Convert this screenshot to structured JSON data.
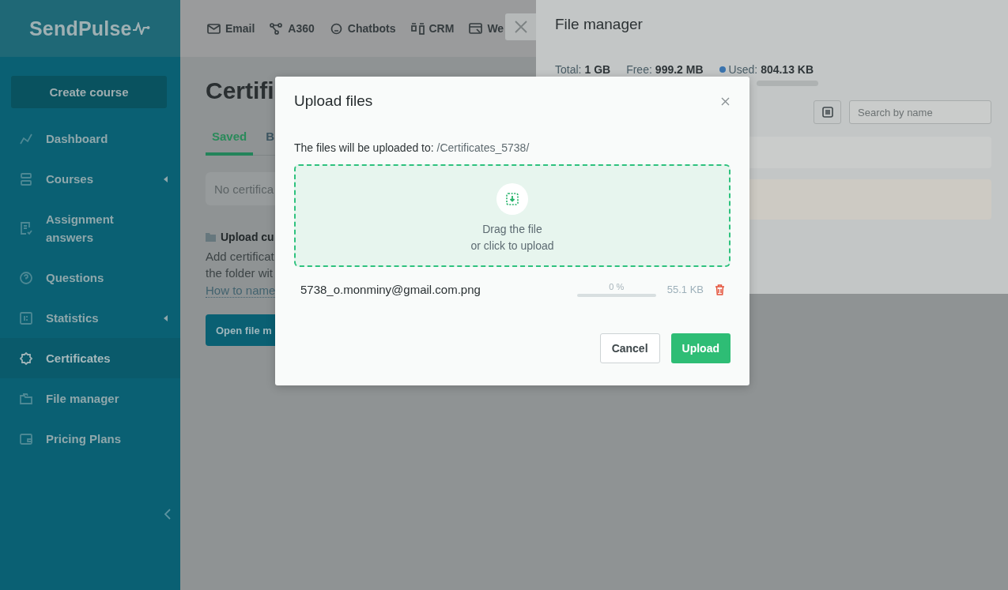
{
  "sidebar": {
    "logo": "SendPulse",
    "create_button": "Create course",
    "items": [
      {
        "label": "Dashboard",
        "selected": false,
        "expandable": false
      },
      {
        "label": "Courses",
        "selected": false,
        "expandable": true
      },
      {
        "label": "Assignment answers",
        "selected": false,
        "expandable": false
      },
      {
        "label": "Questions",
        "selected": false,
        "expandable": false
      },
      {
        "label": "Statistics",
        "selected": false,
        "expandable": true
      },
      {
        "label": "Certificates",
        "selected": true,
        "expandable": false
      },
      {
        "label": "File manager",
        "selected": false,
        "expandable": false
      },
      {
        "label": "Pricing Plans",
        "selected": false,
        "expandable": false
      }
    ]
  },
  "top_nav": [
    {
      "label": "Email"
    },
    {
      "label": "A360"
    },
    {
      "label": "Chatbots"
    },
    {
      "label": "CRM"
    },
    {
      "label": "We"
    }
  ],
  "page": {
    "title": "Certifi",
    "tabs": [
      {
        "label": "Saved",
        "selected": true
      },
      {
        "label": "B",
        "selected": false
      }
    ],
    "empty_message": "No certifica",
    "upload_heading": "Upload cu",
    "description": [
      "Add certificat",
      "the folder wit"
    ],
    "link": "How to name",
    "button": "Open file m"
  },
  "file_manager": {
    "title": "File manager",
    "stats": [
      {
        "label": "Total:",
        "value": "1 GB"
      },
      {
        "label": "Free:",
        "value": "999.2 MB"
      },
      {
        "label": "Used:",
        "value": "804.13 KB",
        "color": "#3a73ad"
      }
    ],
    "search": {
      "placeholder": "Search by name"
    }
  },
  "modal": {
    "title": "Upload files",
    "destination_label": "The files will be uploaded to:",
    "destination_path": "/Certificates_5738/",
    "dropzone": [
      "Drag the file",
      "or click to upload"
    ],
    "files": [
      {
        "name": "5738_o.monminy@gmail.com.png",
        "progress": "0 %",
        "level": 0,
        "size": "55.1 KB"
      }
    ],
    "buttons": [
      {
        "label": "Cancel",
        "kind": "secondary"
      },
      {
        "label": "Upload",
        "kind": "primary"
      }
    ]
  }
}
